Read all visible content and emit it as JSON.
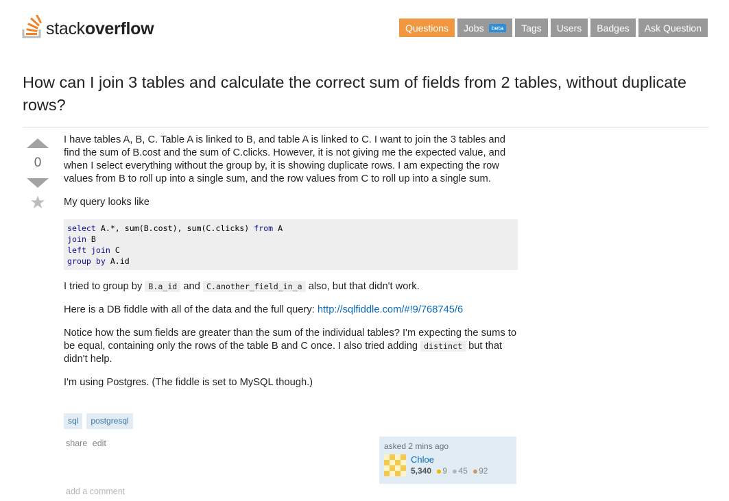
{
  "header": {
    "logo": {
      "text_light": "stack",
      "text_bold": "overflow",
      "icon": "stackoverflow-logo-icon"
    },
    "nav": [
      {
        "label": "Questions",
        "active": true
      },
      {
        "label": "Jobs",
        "badge": "beta"
      },
      {
        "label": "Tags"
      },
      {
        "label": "Users"
      },
      {
        "label": "Badges"
      },
      {
        "label": "Ask Question"
      }
    ]
  },
  "question": {
    "title": "How can I join 3 tables and calculate the correct sum of fields from 2 tables, without duplicate rows?",
    "votes": "0",
    "paragraphs": {
      "p1": "I have tables A, B, C. Table A is linked to B, and table A is linked to C. I want to join the 3 tables and find the sum of B.cost and the sum of C.clicks. However, it is not giving me the expected value, and when I select everything without the group by, it is showing duplicate rows. I am expecting the row values from B to roll up into a single sum, and the row values from C to roll up into a single sum.",
      "p2": "My query looks like",
      "p3_before": "I tried to group by",
      "p3_code1": "B.a_id",
      "p3_and": "and",
      "p3_code2": "C.another_field_in_a",
      "p3_after": "also, but that didn't work.",
      "p4_before": "Here is a DB fiddle with all of the data and the full query:",
      "p4_link": "http://sqlfiddle.com/#!9/768745/6",
      "p5_before": "Notice how the sum fields are greater than the sum of the individual tables? I'm expecting the sums to be equal, containing only the rows of the table B and C once. I also tried adding",
      "p5_code": "distinct",
      "p5_after": "but that didn't help.",
      "p6": "I'm using Postgres. (The fiddle is set to MySQL though.)"
    },
    "code": {
      "l1_kw1": "select",
      "l1_mid": " A.*, sum(B.cost), sum(C.clicks) ",
      "l1_kw2": "from",
      "l1_end": " A",
      "l2_kw": "join",
      "l2_end": " B",
      "l3_kw": "left join",
      "l3_end": " C",
      "l4_kw": "group by",
      "l4_end": " A.id"
    },
    "tags": [
      "sql",
      "postgresql"
    ],
    "actions": {
      "share": "share",
      "edit": "edit"
    },
    "owner": {
      "asked": "asked 2 mins ago",
      "name": "Chloe",
      "reputation": "5,340",
      "gold": "9",
      "silver": "45",
      "bronze": "92",
      "colors": {
        "gold": "#f1b600",
        "silver": "#b4b8bc",
        "bronze": "#cc9966"
      }
    },
    "add_comment": "add a comment"
  },
  "colors": {
    "accent": "#f0973f",
    "nav_bg": "#999999",
    "link": "#0a6bb8",
    "tag_bg": "#e1ecf4"
  }
}
